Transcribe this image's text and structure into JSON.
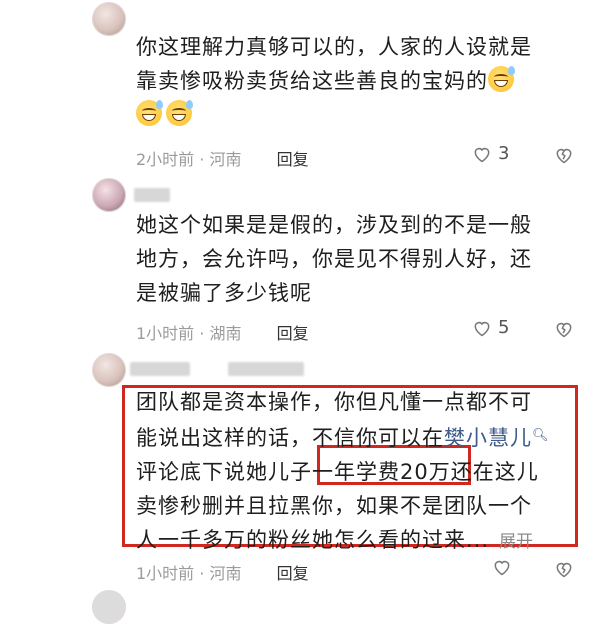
{
  "comments": [
    {
      "lines": [
        "你这理解力真够可以的，人家的人设就是",
        "靠卖惨吸粉卖货给这些善良的宝妈的"
      ],
      "emoji_name": "sweat-smile-emoji",
      "time": "2小时前",
      "location": "河南",
      "reply": "回复",
      "likes": "3"
    },
    {
      "lines": [
        "她这个如果是是假的，涉及到的不是一般",
        "地方，会允许吗，你是见不得别人好，还",
        "是被骗了多少钱呢"
      ],
      "time": "1小时前",
      "location": "湖南",
      "reply": "回复",
      "likes": "5"
    },
    {
      "line1": "团队都是资本操作，你但凡懂一点都不可",
      "line2_pre": "能说出这样的话，不信你可以在",
      "line2_link": "樊小慧儿",
      "line3_pre": "评论底下说她儿子",
      "line3_highlight": "一年学费20万",
      "line3_post": "还在这儿",
      "line4": "卖惨秒删并且拉黑你，如果不是团队一个",
      "line5": "人一千多万的粉丝她怎么看的过来...",
      "expand": "展开",
      "time": "1小时前",
      "location": "河南",
      "reply": "回复"
    }
  ],
  "meta_separator": " · ",
  "highlight_color": "#d0281f",
  "link_color": "#3e5b8a"
}
